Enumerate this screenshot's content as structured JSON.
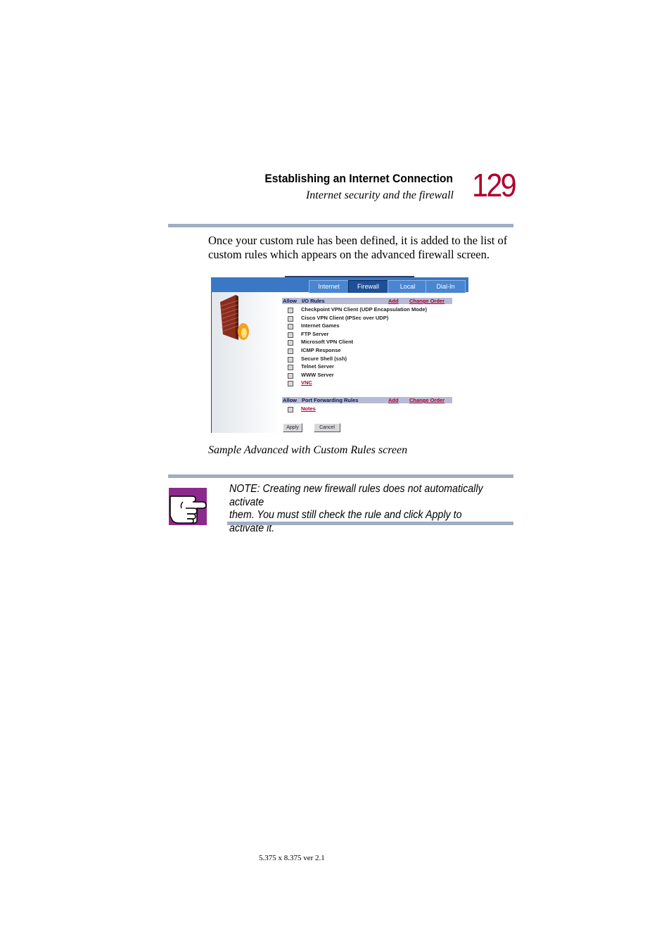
{
  "header": {
    "chapter_title": "Establishing an Internet Connection",
    "section_title": "Internet security and the firewall",
    "page_number": "129"
  },
  "body_text": "Once your custom rule has been defined, it is added to the list of custom rules which appears on the advanced firewall screen.",
  "screenshot": {
    "tabs": [
      {
        "label": "Internet",
        "active": false
      },
      {
        "label": "Firewall",
        "active": true
      },
      {
        "label": "Local",
        "active": false
      },
      {
        "label": "Dial-In",
        "active": false
      }
    ],
    "io_section": {
      "allow_label": "Allow",
      "title": "I/O Rules",
      "add_link": "Add",
      "change_order_link": "Change Order"
    },
    "io_rules": [
      {
        "label": "Checkpoint VPN Client (UDP Encapsulation Mode)",
        "link": false
      },
      {
        "label": "Cisco VPN Client (IPSec over UDP)",
        "link": false
      },
      {
        "label": "Internet Games",
        "link": false
      },
      {
        "label": "FTP Server",
        "link": false
      },
      {
        "label": "Microsoft VPN Client",
        "link": false
      },
      {
        "label": "ICMP Response",
        "link": false
      },
      {
        "label": "Secure Shell (ssh)",
        "link": false
      },
      {
        "label": "Telnet Server",
        "link": false
      },
      {
        "label": "WWW Server",
        "link": false
      },
      {
        "label": "VNC",
        "link": true
      }
    ],
    "pf_section": {
      "allow_label": "Allow",
      "title": "Port Forwarding Rules",
      "add_link": "Add",
      "change_order_link": "Change Order"
    },
    "pf_rules": [
      {
        "label": "Notes",
        "link": true
      }
    ],
    "apply_button": "Apply",
    "cancel_button": "Cancel"
  },
  "caption": "Sample Advanced with Custom Rules screen",
  "note": "NOTE: Creating new firewall rules does not automatically activate\nthem.  You must still check the rule and click Apply to activate it.",
  "footer": "5.375 x 8.375 ver 2.1",
  "colors": {
    "page_number": "#b0002a",
    "rule_bar": "#a0aec0",
    "note_icon": "#8b2a8c",
    "header_blue": "#3a77c4"
  }
}
